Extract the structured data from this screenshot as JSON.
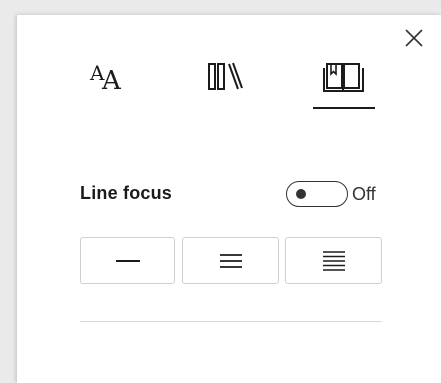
{
  "panel": {
    "close_icon": "close-icon"
  },
  "tabs": [
    {
      "name": "text-preferences",
      "icon": "text-size-icon",
      "selected": false
    },
    {
      "name": "grammar-options",
      "icon": "library-books-icon",
      "selected": false
    },
    {
      "name": "reading-preferences",
      "icon": "open-book-icon",
      "selected": true
    }
  ],
  "reading": {
    "line_focus_label": "Line focus",
    "toggle_state_label": "Off",
    "toggle_on": false,
    "line_focus_options": [
      {
        "icon": "one-line-icon",
        "lines": 1
      },
      {
        "icon": "three-lines-icon",
        "lines": 3
      },
      {
        "icon": "five-lines-icon",
        "lines": 5
      }
    ]
  },
  "colors": {
    "icon": "#1b1b1b",
    "border": "#cfcfcf",
    "divider": "#d9d9d9"
  }
}
